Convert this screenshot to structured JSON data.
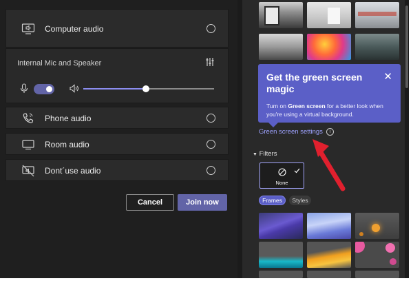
{
  "audio": {
    "computer_audio_label": "Computer audio",
    "device_label": "Internal Mic and Speaker",
    "volume_level": 0.48,
    "mic_enabled": true,
    "phone_audio_label": "Phone audio",
    "room_audio_label": "Room audio",
    "no_audio_label": "Dont´use audio"
  },
  "actions": {
    "cancel_label": "Cancel",
    "join_label": "Join now"
  },
  "popup": {
    "title": "Get the green screen magic",
    "body_prefix": "Turn on ",
    "body_bold": "Green screen",
    "body_suffix": " for a better look when you're using a virtual background."
  },
  "green_screen": {
    "link_label": "Green screen settings",
    "info_icon": "i"
  },
  "filters": {
    "header_label": "Filters",
    "none_label": "None",
    "tabs": [
      "Frames",
      "Styles"
    ]
  },
  "colors": {
    "accent": "#6264a7",
    "popup": "#5b5fc7",
    "link": "#9ea2ff",
    "pointer_arrow": "#e0202e"
  }
}
